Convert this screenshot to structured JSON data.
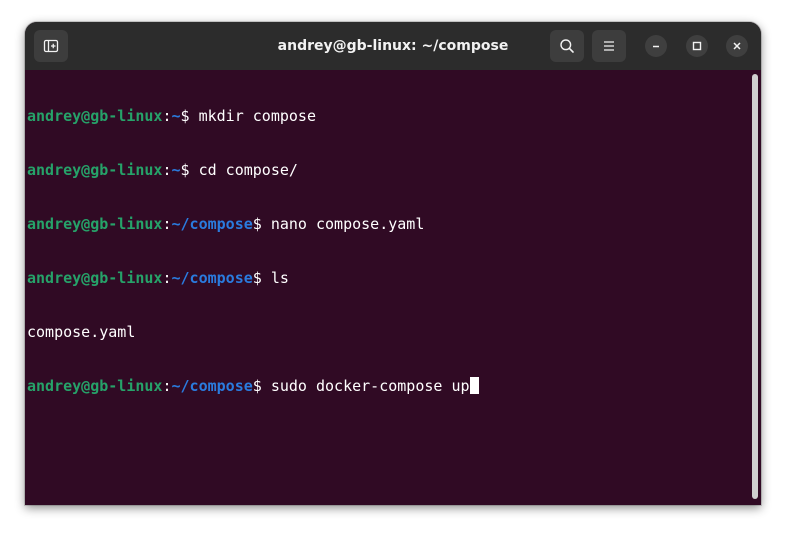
{
  "window": {
    "title": "andrey@gb-linux: ~/compose"
  },
  "titlebar": {
    "new_tab_icon": "new-tab-icon",
    "search_icon": "search-icon",
    "menu_icon": "hamburger-menu-icon",
    "minimize_icon": "minimize-icon",
    "maximize_icon": "maximize-icon",
    "close_icon": "close-icon"
  },
  "terminal": {
    "lines": [
      {
        "user": "andrey@gb-linux",
        "sep": ":",
        "path": "~",
        "prompt": "$ ",
        "command": "mkdir compose"
      },
      {
        "user": "andrey@gb-linux",
        "sep": ":",
        "path": "~",
        "prompt": "$ ",
        "command": "cd compose/"
      },
      {
        "user": "andrey@gb-linux",
        "sep": ":",
        "path": "~/compose",
        "prompt": "$ ",
        "command": "nano compose.yaml"
      },
      {
        "user": "andrey@gb-linux",
        "sep": ":",
        "path": "~/compose",
        "prompt": "$ ",
        "command": "ls"
      },
      {
        "output": "compose.yaml"
      },
      {
        "user": "andrey@gb-linux",
        "sep": ":",
        "path": "~/compose",
        "prompt": "$ ",
        "command": "sudo docker-compose up"
      }
    ]
  },
  "colors": {
    "terminal_bg": "#300a24",
    "user_green": "#26a269",
    "path_blue": "#2a7bde",
    "titlebar_bg": "#2c2c2c"
  }
}
